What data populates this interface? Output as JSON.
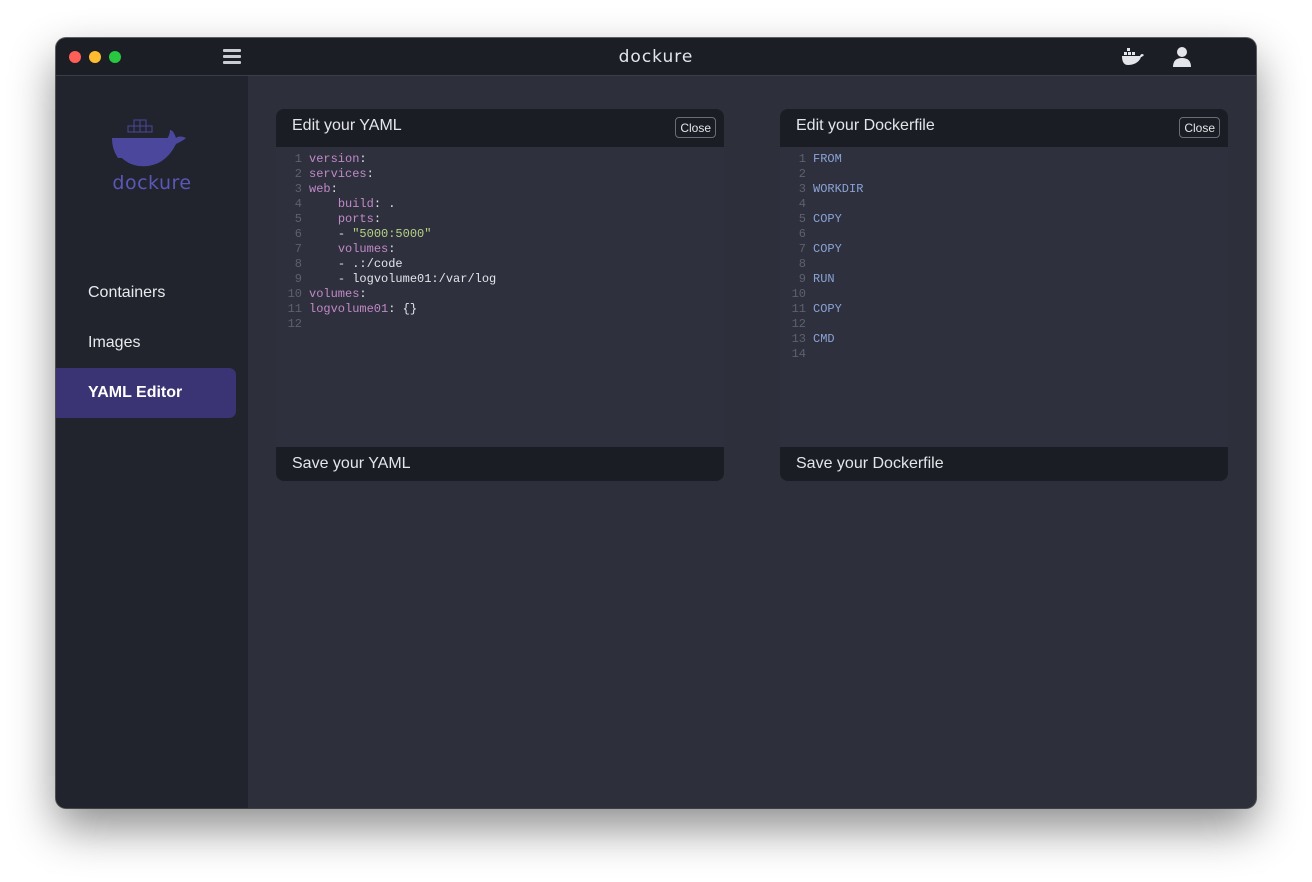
{
  "window": {
    "title": "dockure"
  },
  "sidebar": {
    "logo_text": "dockure",
    "items": [
      {
        "label": "Containers",
        "active": false
      },
      {
        "label": "Images",
        "active": false
      },
      {
        "label": "YAML Editor",
        "active": true
      }
    ]
  },
  "yaml_panel": {
    "title": "Edit your YAML",
    "close_label": "Close",
    "save_label": "Save your YAML",
    "lines": [
      {
        "num": "1",
        "key": "version",
        "sep": ":",
        "val": ""
      },
      {
        "num": "2",
        "key": "services",
        "sep": ":",
        "val": ""
      },
      {
        "num": "3",
        "key": "web",
        "sep": ":",
        "val": ""
      },
      {
        "num": "4",
        "indent": "    ",
        "key": "build",
        "sep": ": ",
        "val": "."
      },
      {
        "num": "5",
        "indent": "    ",
        "key": "ports",
        "sep": ":",
        "val": ""
      },
      {
        "num": "6",
        "indent": "    ",
        "key": "",
        "sep": "- ",
        "str": "\"5000:5000\""
      },
      {
        "num": "7",
        "indent": "    ",
        "key": "volumes",
        "sep": ":",
        "val": ""
      },
      {
        "num": "8",
        "indent": "    ",
        "key": "",
        "sep": "- ",
        "val": ".:/code"
      },
      {
        "num": "9",
        "indent": "    ",
        "key": "",
        "sep": "- ",
        "val": "logvolume01:/var/log"
      },
      {
        "num": "10",
        "key": "volumes",
        "sep": ":",
        "val": ""
      },
      {
        "num": "11",
        "key": "logvolume01",
        "sep": ": ",
        "val": "{}"
      },
      {
        "num": "12",
        "key": "",
        "sep": "",
        "val": ""
      }
    ]
  },
  "dockerfile_panel": {
    "title": "Edit your Dockerfile",
    "close_label": "Close",
    "save_label": "Save your Dockerfile",
    "lines": [
      {
        "num": "1",
        "kw": "FROM"
      },
      {
        "num": "2",
        "kw": ""
      },
      {
        "num": "3",
        "kw": "WORKDIR"
      },
      {
        "num": "4",
        "kw": ""
      },
      {
        "num": "5",
        "kw": "COPY"
      },
      {
        "num": "6",
        "kw": ""
      },
      {
        "num": "7",
        "kw": "COPY"
      },
      {
        "num": "8",
        "kw": ""
      },
      {
        "num": "9",
        "kw": "RUN"
      },
      {
        "num": "10",
        "kw": ""
      },
      {
        "num": "11",
        "kw": "COPY"
      },
      {
        "num": "12",
        "kw": ""
      },
      {
        "num": "13",
        "kw": "CMD"
      },
      {
        "num": "14",
        "kw": ""
      }
    ]
  },
  "icons": {
    "menu": "hamburger-menu-icon",
    "docker": "docker-whale-icon",
    "user": "user-icon"
  },
  "colors": {
    "accent": "#3a3474",
    "logo": "#5b57b8",
    "yaml_key": "#c189c7",
    "yaml_string": "#b6d284",
    "docker_keyword": "#8aa3d6"
  }
}
